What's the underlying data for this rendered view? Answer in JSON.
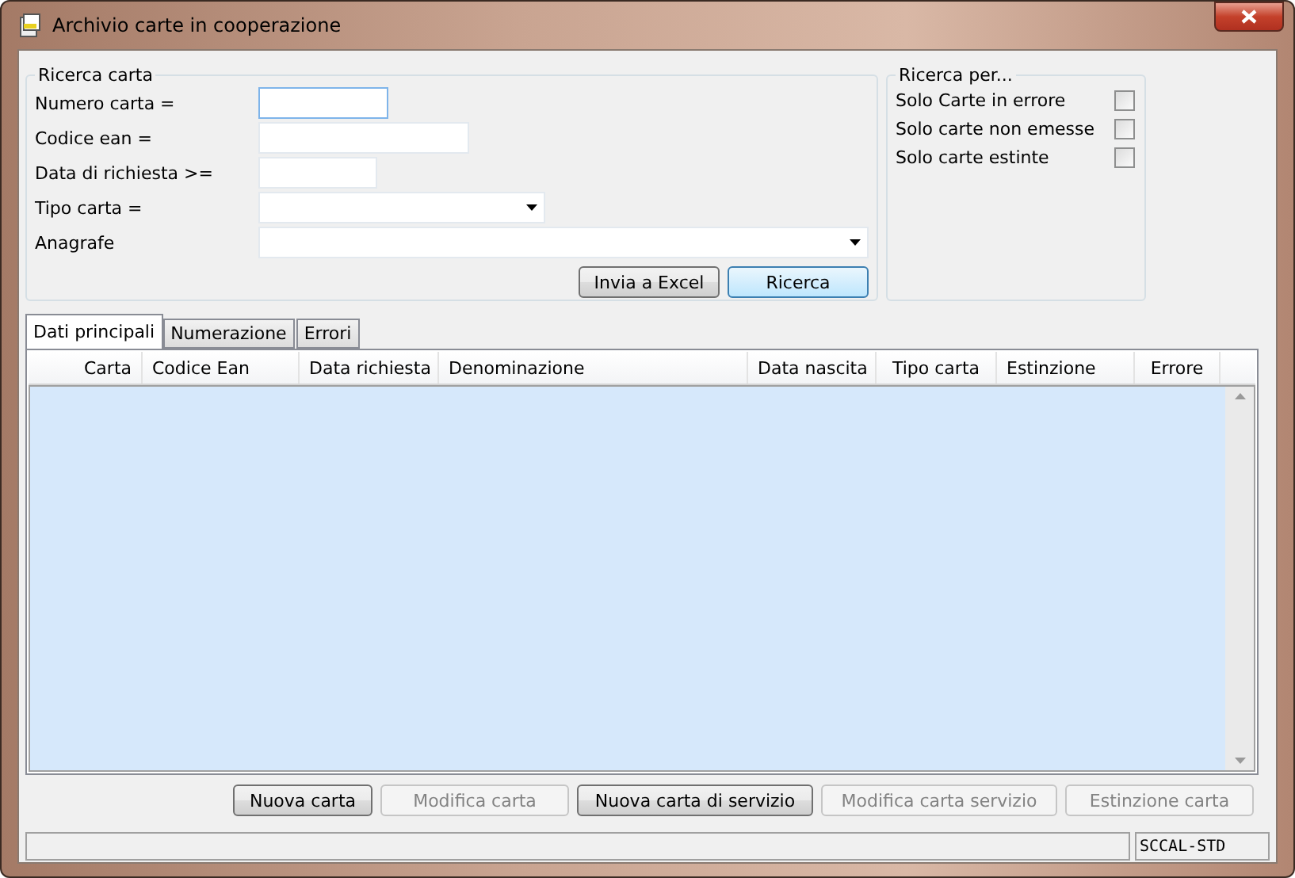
{
  "window": {
    "title": "Archivio carte in cooperazione"
  },
  "search": {
    "title": "Ricerca carta",
    "fields": [
      {
        "label": "Numero carta =",
        "kind": "text",
        "focused": true
      },
      {
        "label": "Codice ean =",
        "kind": "text",
        "focused": false
      },
      {
        "label": "Data di richiesta >=",
        "kind": "text",
        "focused": false
      },
      {
        "label": "Tipo carta =",
        "kind": "combo",
        "focused": false
      },
      {
        "label": "Anagrafe",
        "kind": "combo",
        "focused": false
      }
    ],
    "buttons": [
      {
        "label": "Invia a Excel",
        "default": false
      },
      {
        "label": "Ricerca",
        "default": true
      }
    ]
  },
  "filters": {
    "title": "Ricerca per...",
    "options": [
      {
        "label": "Solo Carte in errore",
        "checked": false
      },
      {
        "label": "Solo carte non emesse",
        "checked": false
      },
      {
        "label": "Solo carte estinte",
        "checked": false
      }
    ]
  },
  "tabs": [
    {
      "label": "Dati principali",
      "selected": true
    },
    {
      "label": "Numerazione",
      "selected": false
    },
    {
      "label": "Errori",
      "selected": false
    }
  ],
  "table": {
    "columns": [
      "Carta",
      "Codice Ean",
      "Data richiesta",
      "Denominazione",
      "Data nascita",
      "Tipo carta",
      "Estinzione",
      "Errore"
    ]
  },
  "actions": [
    {
      "label": "Nuova carta",
      "disabled": false
    },
    {
      "label": "Modifica carta",
      "disabled": true
    },
    {
      "label": "Nuova carta di servizio",
      "disabled": false
    },
    {
      "label": "Modifica carta servizio",
      "disabled": true
    },
    {
      "label": "Estinzione carta",
      "disabled": true
    }
  ],
  "status_bar": {
    "panel": "SCCAL-STD"
  }
}
